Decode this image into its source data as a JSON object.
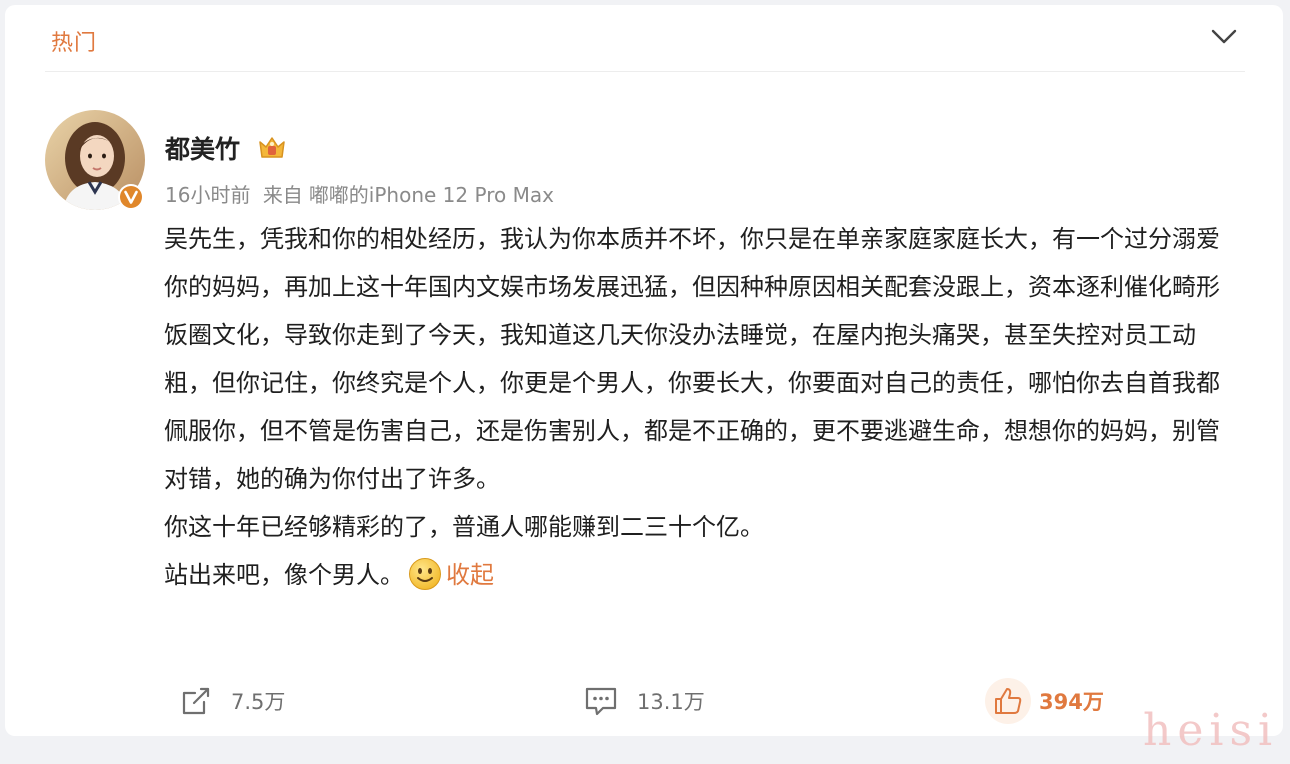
{
  "header": {
    "title": "热门",
    "toggle_icon": "chevron-down-icon"
  },
  "post": {
    "author": {
      "name": "都美竹",
      "badge_icon": "crown-icon",
      "verified_icon": "verified-v-icon"
    },
    "meta": {
      "time": "16小时前",
      "source_prefix": "来自",
      "source_device": "嘟嘟的iPhone 12 Pro Max"
    },
    "paragraphs": [
      "吴先生，凭我和你的相处经历，我认为你本质并不坏，你只是在单亲家庭家庭长大，有一个过分溺爱你的妈妈，再加上这十年国内文娱市场发展迅猛，但因种种原因相关配套没跟上，资本逐利催化畸形饭圈文化，导致你走到了今天，我知道这几天你没办法睡觉，在屋内抱头痛哭，甚至失控对员工动粗，但你记住，你终究是个人，你更是个男人，你要长大，你要面对自己的责任，哪怕你去自首我都佩服你，但不管是伤害自己，还是伤害别人，都是不正确的，更不要逃避生命，想想你的妈妈，别管对错，她的确为你付出了许多。",
      "你这十年已经够精彩的了，普通人哪能赚到二三十个亿。"
    ],
    "last_line": "站出来吧，像个男人。",
    "emoji_icon": "smile-emoji-icon",
    "collapse_label": "收起"
  },
  "actions": {
    "share": {
      "icon": "share-icon",
      "count": "7.5万"
    },
    "comment": {
      "icon": "comment-icon",
      "count": "13.1万"
    },
    "like": {
      "icon": "thumbs-up-icon",
      "count": "394万"
    }
  },
  "watermark": "heisi",
  "colors": {
    "accent": "#e0793f",
    "text": "#1f1f1f",
    "meta": "#8a8a8a",
    "verified": "#e0872b",
    "background": "#f1f2f5"
  }
}
